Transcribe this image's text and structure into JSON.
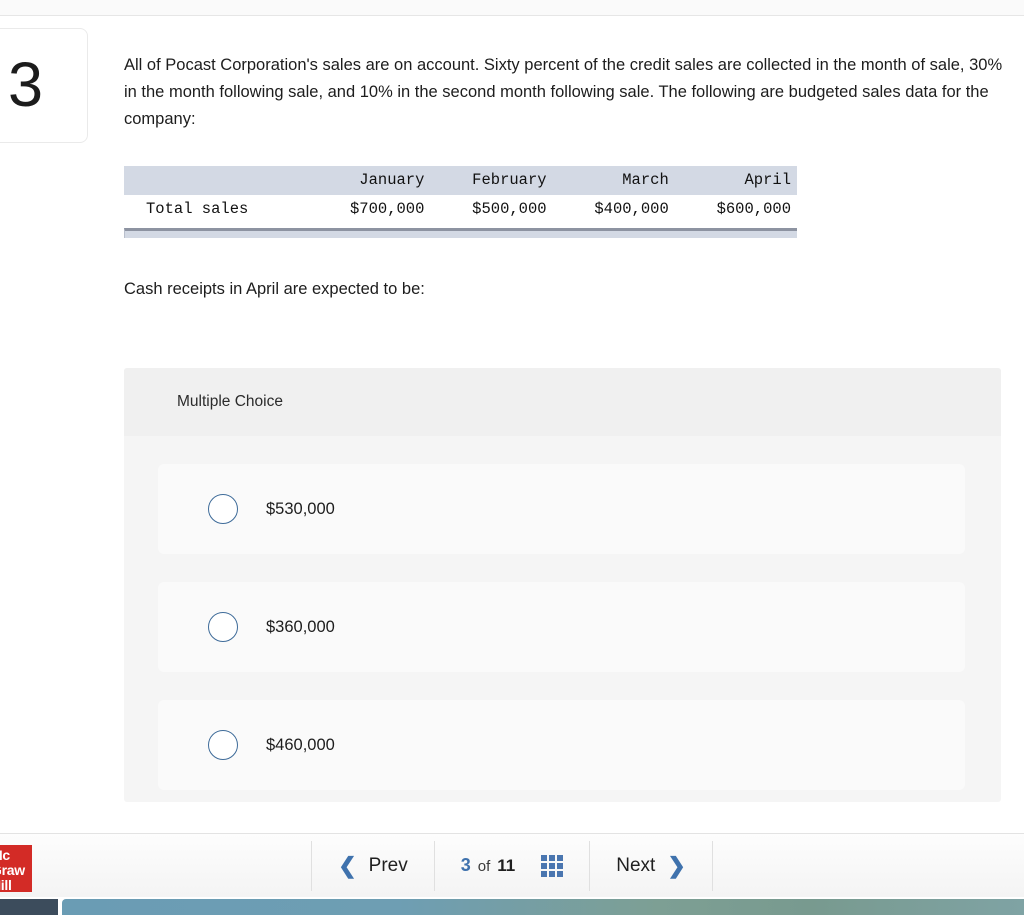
{
  "question": {
    "number": "3",
    "stem": "All of Pocast Corporation's sales are on account. Sixty percent of the credit sales are collected in the month of sale, 30% in the month following sale, and 10% in the second month following sale. The following are budgeted sales data for the company:",
    "prompt": "Cash receipts in April are expected to be:"
  },
  "table": {
    "corner_header": "",
    "columns": [
      "January",
      "February",
      "March",
      "April"
    ],
    "rows": [
      {
        "label": "Total sales",
        "values": [
          "$700,000",
          "$500,000",
          "$400,000",
          "$600,000"
        ]
      }
    ]
  },
  "answer_panel": {
    "type_label": "Multiple Choice",
    "options": [
      {
        "text": "$530,000",
        "selected": false
      },
      {
        "text": "$360,000",
        "selected": false
      },
      {
        "text": "$460,000",
        "selected": false
      }
    ]
  },
  "navigation": {
    "prev_label": "Prev",
    "prev_icon": "chevron-left-icon",
    "next_label": "Next",
    "next_icon": "chevron-right-icon",
    "current_page": "3",
    "of_label": "of",
    "total_pages": "11",
    "grid_icon": "grid-view-icon"
  },
  "brand": {
    "line1": "Mc",
    "line2": "Graw",
    "line3": "Hill",
    "color": "#d32b26"
  },
  "colors": {
    "accent_blue": "#3f72ad",
    "radio_border": "#3e6b99",
    "table_header": "#d3d9e4",
    "panel_bg": "#f5f5f5",
    "panel_header_bg": "#f0f0f0"
  }
}
